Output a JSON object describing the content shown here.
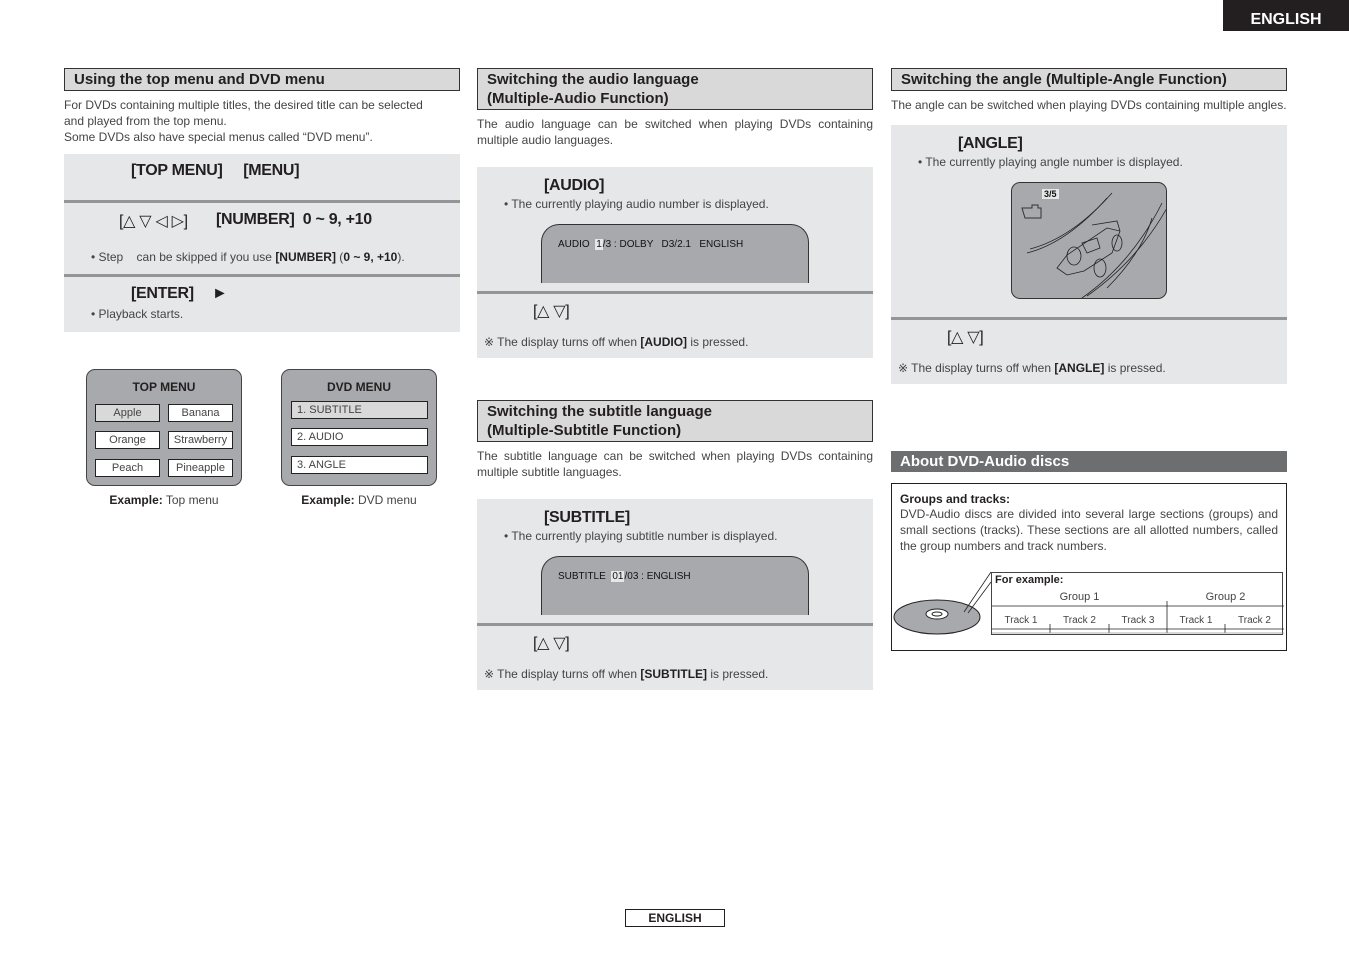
{
  "corner_tab": "ENGLISH",
  "footer_tab": "ENGLISH",
  "section1": {
    "title": "Using the top menu and DVD menu",
    "intro": [
      "For DVDs containing multiple titles, the desired title can be selected",
      "and played from the top menu.",
      "Some DVDs also have special menus called “DVD menu”."
    ],
    "step1_keys": "[TOP MENU]     [MENU]",
    "step2_keys_arrows": "[△ ▽ ◁ ▷]",
    "step2_keys_number": "[NUMBER]  0 ~ 9, +10",
    "step2_bullet_pre": "• Step    can be skipped if you use ",
    "step2_bullet_key": "[NUMBER]",
    "step2_bullet_mid": " (",
    "step2_bullet_range": "0 ~ 9, +10",
    "step2_bullet_post": ").",
    "step3_key": "[ENTER]",
    "step3_play_symbol": "►",
    "step3_bullet": "• Playback starts.",
    "top_menu": {
      "title": "TOP MENU",
      "items": [
        "Apple",
        "Banana",
        "Orange",
        "Strawberry",
        "Peach",
        "Pineapple"
      ],
      "selected": "Apple",
      "caption_bold": "Example:",
      "caption_text": " Top menu"
    },
    "dvd_menu": {
      "title": "DVD MENU",
      "items": [
        "1. SUBTITLE",
        "2. AUDIO",
        "3. ANGLE"
      ],
      "selected": "1. SUBTITLE",
      "caption_bold": "Example:",
      "caption_text": " DVD menu"
    }
  },
  "section2": {
    "title_line1": "Switching the audio language",
    "title_line2": "(Multiple-Audio Function)",
    "intro": "The audio language can be switched when playing DVDs containing multiple audio languages.",
    "step1_key": "[AUDIO]",
    "step1_bullet": "• The currently playing audio number is displayed.",
    "osd_prefix": "AUDIO  ",
    "osd_highlight": "1",
    "osd_suffix": "/3 : DOLBY   D3/2.1   ENGLISH",
    "step2_keys": "[△ ▽]",
    "note_pre": "※ The display turns off when ",
    "note_key": "[AUDIO]",
    "note_post": " is pressed."
  },
  "section3": {
    "title_line1": "Switching the subtitle language",
    "title_line2": "(Multiple-Subtitle Function)",
    "intro": "The subtitle language can be switched when playing DVDs containing multiple subtitle languages.",
    "step1_key": "[SUBTITLE]",
    "step1_bullet": "• The currently playing subtitle number is displayed.",
    "osd_prefix": "SUBTITLE  ",
    "osd_highlight": "01",
    "osd_suffix": "/03 : ENGLISH",
    "step2_keys": "[△ ▽]",
    "note_pre": "※ The display turns off when ",
    "note_key": "[SUBTITLE]",
    "note_post": " is pressed."
  },
  "section4": {
    "title": "Switching the angle (Multiple-Angle Function)",
    "intro": "The angle can be switched when playing DVDs containing multiple angles.",
    "step1_key": "[ANGLE]",
    "step1_bullet": "• The currently playing angle number is displayed.",
    "osd_angle": "3/5",
    "step2_keys": "[△ ▽]",
    "note_pre": "※ The display turns off when ",
    "note_key": "[ANGLE]",
    "note_post": " is pressed."
  },
  "section5": {
    "title": "About DVD-Audio discs",
    "subtitle": "Groups and tracks:",
    "text": "DVD-Audio discs are divided into several large sections (groups) and small sections (tracks). These sections are all allotted numbers, called the group numbers and track numbers.",
    "example_label": "For example:",
    "groups": [
      "Group 1",
      "Group 2"
    ],
    "tracks_group1": [
      "Track 1",
      "Track 2",
      "Track 3"
    ],
    "tracks_group2": [
      "Track 1",
      "Track 2"
    ]
  }
}
